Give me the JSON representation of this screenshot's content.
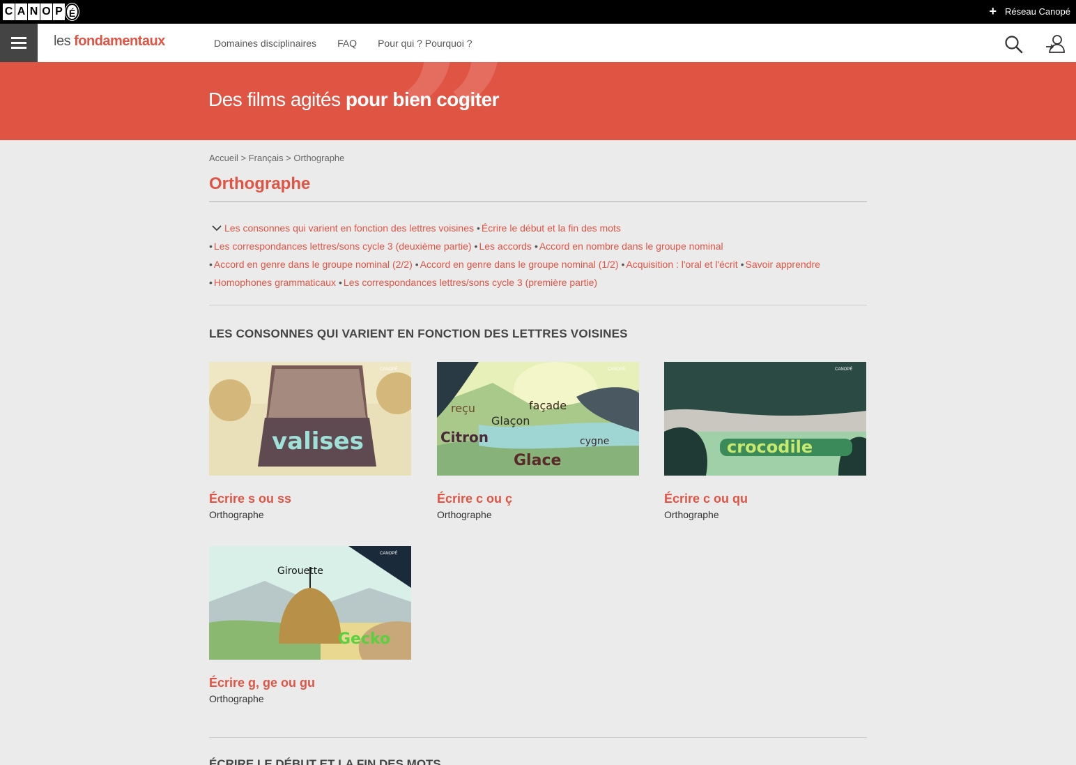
{
  "topbar": {
    "logo_letters": [
      "C",
      "A",
      "N",
      "O",
      "P",
      "É"
    ],
    "reseau_label": "Réseau Canopé"
  },
  "nav": {
    "brand_les": "les ",
    "brand_fond": "fondamentaux",
    "links": [
      "Domaines disciplinaires",
      "FAQ",
      "Pour qui ? Pourquoi ?"
    ]
  },
  "hero": {
    "text_light": "Des films agités ",
    "text_bold": "pour bien cogiter",
    "accent": "#e05444"
  },
  "breadcrumb": "Accueil > Français > Orthographe",
  "page_title": "Orthographe",
  "topics": {
    "line1": [
      "Les consonnes qui varient en fonction des lettres voisines",
      "Écrire le début et la fin des mots"
    ],
    "line2": [
      "Les correspondances lettres/sons cycle 3 (deuxième partie)",
      "Les accords",
      "Accord en nombre dans le groupe nominal"
    ],
    "line3": [
      "Accord en genre dans le groupe nominal (2/2)",
      "Accord en genre dans le groupe nominal (1/2)",
      "Acquisition : l'oral et l'écrit",
      "Savoir apprendre"
    ],
    "line4": [
      "Homophones grammaticaux",
      "Les correspondances lettres/sons cycle 3 (première partie)"
    ]
  },
  "section_title": "LES CONSONNES QUI VARIENT EN FONCTION DES LETTRES VOISINES",
  "cards": [
    {
      "title": "Écrire s ou ss",
      "subtitle": "Orthographe",
      "thumb_words": [
        "valises"
      ]
    },
    {
      "title": "Écrire c ou ç",
      "subtitle": "Orthographe",
      "thumb_words": [
        "reçu",
        "façade",
        "Glaçon",
        "Citron",
        "cygne",
        "Glace"
      ]
    },
    {
      "title": "Écrire c ou qu",
      "subtitle": "Orthographe",
      "thumb_words": [
        "crocodile"
      ]
    },
    {
      "title": "Écrire g, ge ou gu",
      "subtitle": "Orthographe",
      "thumb_words": [
        "Girouette",
        "Gecko"
      ]
    }
  ],
  "thumb_badge": "CANOPÉ",
  "next_section_title": "ÉCRIRE LE DÉBUT ET LA FIN DES MOTS"
}
